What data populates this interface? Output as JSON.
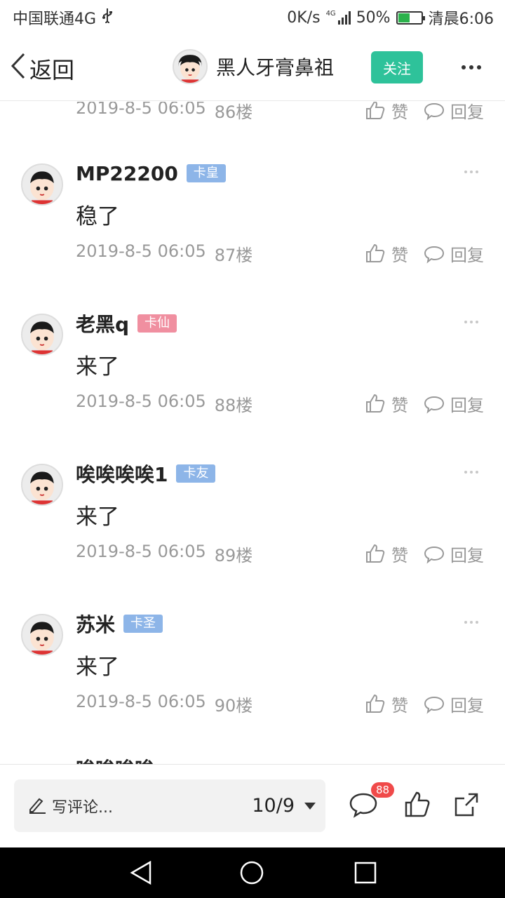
{
  "status_bar": {
    "carrier": "中国联通4G",
    "usb_icon": "usb-icon",
    "speed": "0K/s",
    "network": "4G",
    "battery_percent": "50%",
    "battery_level": 0.5,
    "time": "清晨6:06"
  },
  "nav": {
    "back_label": "返回",
    "title": "黑人牙膏鼻祖",
    "follow_label": "关注",
    "accent_color": "#2ec29a"
  },
  "top_meta": {
    "time": "2019-8-5 06:05",
    "floor": "86楼",
    "like_label": "赞",
    "reply_label": "回复"
  },
  "comments": [
    {
      "name": "MP22200",
      "badge": "卡皇",
      "badge_color": "#8db5e8",
      "content": "稳了",
      "time": "2019-8-5 06:05",
      "floor": "87楼",
      "like_label": "赞",
      "reply_label": "回复"
    },
    {
      "name": "老黑q",
      "badge": "卡仙",
      "badge_color": "#f08fa0",
      "content": "来了",
      "time": "2019-8-5 06:05",
      "floor": "88楼",
      "like_label": "赞",
      "reply_label": "回复"
    },
    {
      "name": "唉唉唉唉1",
      "badge": "卡友",
      "badge_color": "#8db5e8",
      "content": "来了",
      "time": "2019-8-5 06:05",
      "floor": "89楼",
      "like_label": "赞",
      "reply_label": "回复"
    },
    {
      "name": "苏米",
      "badge": "卡圣",
      "badge_color": "#8db5e8",
      "content": "来了",
      "time": "2019-8-5 06:05",
      "floor": "90楼",
      "like_label": "赞",
      "reply_label": "回复"
    }
  ],
  "partial_next_name": "唉唉唉唉",
  "bottom_bar": {
    "placeholder": "写评论...",
    "page_indicator": "10/9",
    "comment_count": "88"
  }
}
